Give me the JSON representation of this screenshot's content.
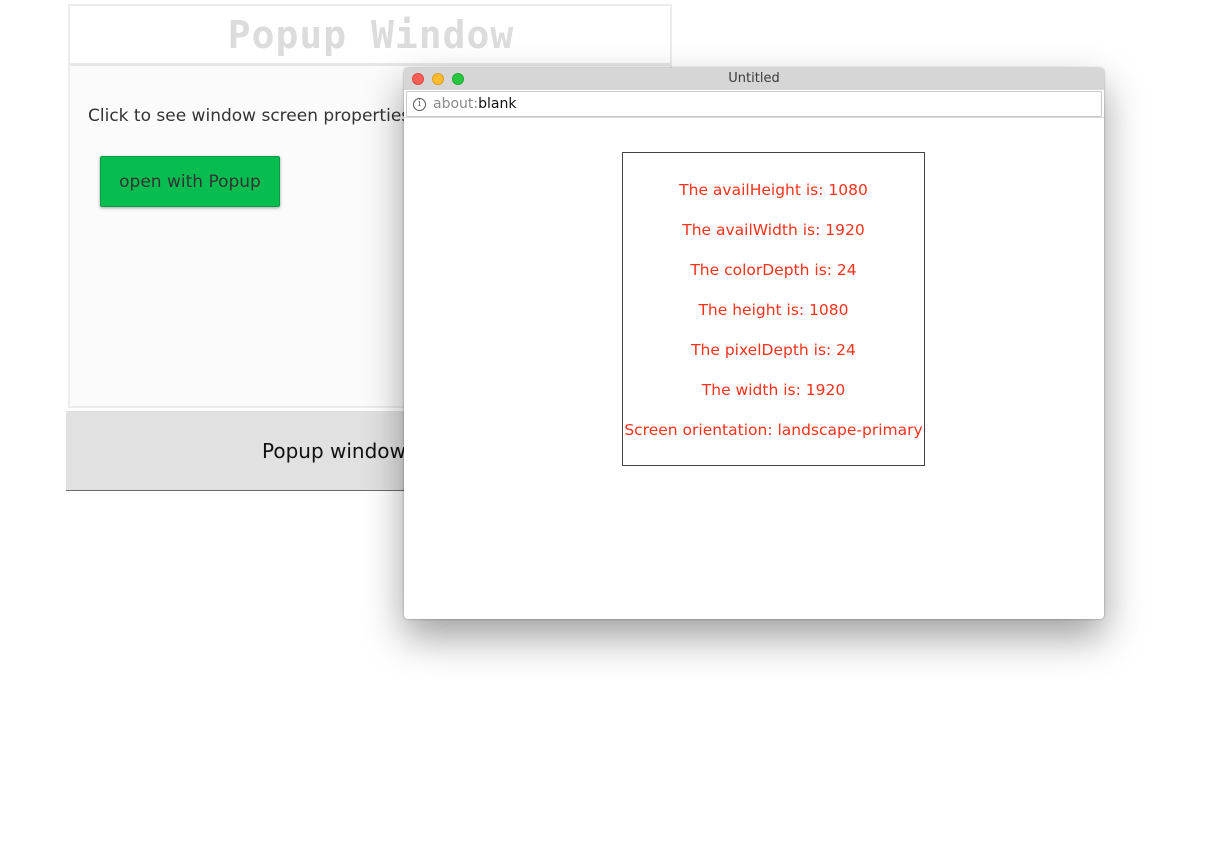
{
  "page": {
    "title": "Popup Window",
    "prompt": "Click to see window screen properties:",
    "open_button_label": "open with Popup",
    "footer_text": "Popup window"
  },
  "popup": {
    "window_title": "Untitled",
    "url_scheme": "about:",
    "url_rest": "blank",
    "properties": [
      "The availHeight is: 1080",
      "The availWidth is: 1920",
      "The colorDepth is: 24",
      "The height is: 1080",
      "The pixelDepth is: 24",
      "The width is: 1920",
      "Screen orientation: landscape-primary"
    ]
  },
  "colors": {
    "button_bg": "#08bd50",
    "property_text": "#f5321c",
    "title_text": "#dcdcdc"
  },
  "icons": {
    "url_info": "info-icon",
    "window_close": "close-window-icon",
    "window_minimize": "minimize-window-icon",
    "window_maximize": "maximize-window-icon"
  }
}
